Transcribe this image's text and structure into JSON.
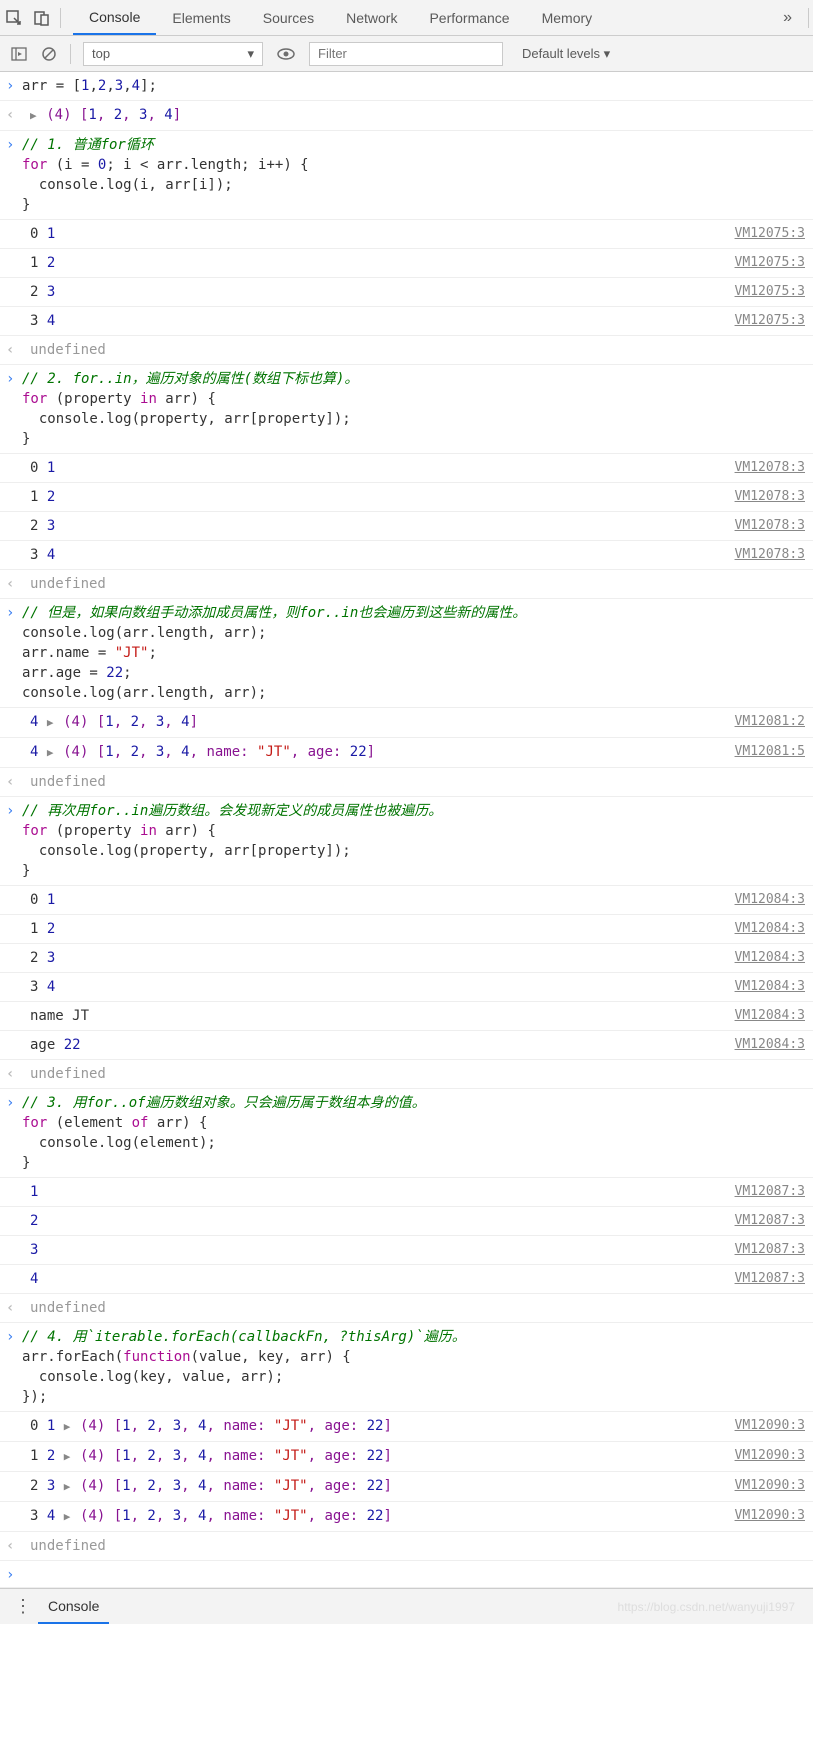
{
  "toolbar": {
    "tabs": [
      "Console",
      "Elements",
      "Sources",
      "Network",
      "Performance",
      "Memory"
    ],
    "active_tab": "Console"
  },
  "subbar": {
    "context": "top",
    "filter_placeholder": "Filter",
    "levels": "Default levels ▾"
  },
  "drawer": {
    "tab": "Console"
  },
  "watermark": "https://blog.csdn.net/wanyuji1997",
  "rows": [
    {
      "t": "in",
      "segs": [
        {
          "txt": "arr = [",
          "cls": ""
        },
        {
          "txt": "1",
          "cls": "num"
        },
        {
          "txt": ",",
          "cls": ""
        },
        {
          "txt": "2",
          "cls": "num"
        },
        {
          "txt": ",",
          "cls": ""
        },
        {
          "txt": "3",
          "cls": "num"
        },
        {
          "txt": ",",
          "cls": ""
        },
        {
          "txt": "4",
          "cls": "num"
        },
        {
          "txt": "];",
          "cls": ""
        }
      ]
    },
    {
      "t": "out",
      "segs": [
        {
          "txt": "▶ ",
          "cls": "tri"
        },
        {
          "txt": "(4) ",
          "cls": "propname"
        },
        {
          "txt": "[",
          "cls": "propname"
        },
        {
          "txt": "1",
          "cls": "num"
        },
        {
          "txt": ", ",
          "cls": "propname"
        },
        {
          "txt": "2",
          "cls": "num"
        },
        {
          "txt": ", ",
          "cls": "propname"
        },
        {
          "txt": "3",
          "cls": "num"
        },
        {
          "txt": ", ",
          "cls": "propname"
        },
        {
          "txt": "4",
          "cls": "num"
        },
        {
          "txt": "]",
          "cls": "propname"
        }
      ]
    },
    {
      "t": "in",
      "segs": [
        {
          "txt": "// 1. 普通for循环",
          "cls": "comment"
        },
        {
          "txt": "\n",
          "cls": ""
        },
        {
          "txt": "for",
          "cls": "kw"
        },
        {
          "txt": " (i = ",
          "cls": ""
        },
        {
          "txt": "0",
          "cls": "num"
        },
        {
          "txt": "; i < arr.length; i++) {\n  console.log(i, arr[i]);\n}",
          "cls": ""
        }
      ]
    },
    {
      "t": "log",
      "src": "VM12075:3",
      "segs": [
        {
          "txt": "0 ",
          "cls": ""
        },
        {
          "txt": "1",
          "cls": "num"
        }
      ]
    },
    {
      "t": "log",
      "src": "VM12075:3",
      "segs": [
        {
          "txt": "1 ",
          "cls": ""
        },
        {
          "txt": "2",
          "cls": "num"
        }
      ]
    },
    {
      "t": "log",
      "src": "VM12075:3",
      "segs": [
        {
          "txt": "2 ",
          "cls": ""
        },
        {
          "txt": "3",
          "cls": "num"
        }
      ]
    },
    {
      "t": "log",
      "src": "VM12075:3",
      "segs": [
        {
          "txt": "3 ",
          "cls": ""
        },
        {
          "txt": "4",
          "cls": "num"
        }
      ]
    },
    {
      "t": "out",
      "segs": [
        {
          "txt": "undefined",
          "cls": "undef"
        }
      ]
    },
    {
      "t": "in",
      "segs": [
        {
          "txt": "// 2. for..in，遍历对象的属性(数组下标也算)。",
          "cls": "comment"
        },
        {
          "txt": "\n",
          "cls": ""
        },
        {
          "txt": "for",
          "cls": "kw"
        },
        {
          "txt": " (property ",
          "cls": ""
        },
        {
          "txt": "in",
          "cls": "kw"
        },
        {
          "txt": " arr) {\n  console.log(property, arr[property]);\n}",
          "cls": ""
        }
      ]
    },
    {
      "t": "log",
      "src": "VM12078:3",
      "segs": [
        {
          "txt": "0 ",
          "cls": ""
        },
        {
          "txt": "1",
          "cls": "num"
        }
      ]
    },
    {
      "t": "log",
      "src": "VM12078:3",
      "segs": [
        {
          "txt": "1 ",
          "cls": ""
        },
        {
          "txt": "2",
          "cls": "num"
        }
      ]
    },
    {
      "t": "log",
      "src": "VM12078:3",
      "segs": [
        {
          "txt": "2 ",
          "cls": ""
        },
        {
          "txt": "3",
          "cls": "num"
        }
      ]
    },
    {
      "t": "log",
      "src": "VM12078:3",
      "segs": [
        {
          "txt": "3 ",
          "cls": ""
        },
        {
          "txt": "4",
          "cls": "num"
        }
      ]
    },
    {
      "t": "out",
      "segs": [
        {
          "txt": "undefined",
          "cls": "undef"
        }
      ]
    },
    {
      "t": "in",
      "segs": [
        {
          "txt": "// 但是，如果向数组手动添加成员属性，则for..in也会遍历到这些新的属性。",
          "cls": "comment"
        },
        {
          "txt": "\n",
          "cls": ""
        },
        {
          "txt": "console.log(arr.length, arr);\narr.name = ",
          "cls": ""
        },
        {
          "txt": "\"JT\"",
          "cls": "str"
        },
        {
          "txt": ";\narr.age = ",
          "cls": ""
        },
        {
          "txt": "22",
          "cls": "num"
        },
        {
          "txt": ";\nconsole.log(arr.length, arr);",
          "cls": ""
        }
      ]
    },
    {
      "t": "log",
      "src": "VM12081:2",
      "segs": [
        {
          "txt": "4 ",
          "cls": "num"
        },
        {
          "txt": "▶ ",
          "cls": "tri"
        },
        {
          "txt": "(4) ",
          "cls": "propname"
        },
        {
          "txt": "[",
          "cls": "propname"
        },
        {
          "txt": "1",
          "cls": "num"
        },
        {
          "txt": ", ",
          "cls": "propname"
        },
        {
          "txt": "2",
          "cls": "num"
        },
        {
          "txt": ", ",
          "cls": "propname"
        },
        {
          "txt": "3",
          "cls": "num"
        },
        {
          "txt": ", ",
          "cls": "propname"
        },
        {
          "txt": "4",
          "cls": "num"
        },
        {
          "txt": "]",
          "cls": "propname"
        }
      ]
    },
    {
      "t": "log",
      "src": "VM12081:5",
      "segs": [
        {
          "txt": "4 ",
          "cls": "num"
        },
        {
          "txt": "▶ ",
          "cls": "tri"
        },
        {
          "txt": "(4) ",
          "cls": "propname"
        },
        {
          "txt": "[",
          "cls": "propname"
        },
        {
          "txt": "1",
          "cls": "num"
        },
        {
          "txt": ", ",
          "cls": "propname"
        },
        {
          "txt": "2",
          "cls": "num"
        },
        {
          "txt": ", ",
          "cls": "propname"
        },
        {
          "txt": "3",
          "cls": "num"
        },
        {
          "txt": ", ",
          "cls": "propname"
        },
        {
          "txt": "4",
          "cls": "num"
        },
        {
          "txt": ", ",
          "cls": "propname"
        },
        {
          "txt": "name",
          "cls": "propname"
        },
        {
          "txt": ": ",
          "cls": "propname"
        },
        {
          "txt": "\"JT\"",
          "cls": "str"
        },
        {
          "txt": ", ",
          "cls": "propname"
        },
        {
          "txt": "age",
          "cls": "propname"
        },
        {
          "txt": ": ",
          "cls": "propname"
        },
        {
          "txt": "22",
          "cls": "num"
        },
        {
          "txt": "]",
          "cls": "propname"
        }
      ]
    },
    {
      "t": "out",
      "segs": [
        {
          "txt": "undefined",
          "cls": "undef"
        }
      ]
    },
    {
      "t": "in",
      "segs": [
        {
          "txt": "// 再次用for..in遍历数组。会发现新定义的成员属性也被遍历。",
          "cls": "comment"
        },
        {
          "txt": "\n",
          "cls": ""
        },
        {
          "txt": "for",
          "cls": "kw"
        },
        {
          "txt": " (property ",
          "cls": ""
        },
        {
          "txt": "in",
          "cls": "kw"
        },
        {
          "txt": " arr) {\n  console.log(property, arr[property]);\n}",
          "cls": ""
        }
      ]
    },
    {
      "t": "log",
      "src": "VM12084:3",
      "segs": [
        {
          "txt": "0 ",
          "cls": ""
        },
        {
          "txt": "1",
          "cls": "num"
        }
      ]
    },
    {
      "t": "log",
      "src": "VM12084:3",
      "segs": [
        {
          "txt": "1 ",
          "cls": ""
        },
        {
          "txt": "2",
          "cls": "num"
        }
      ]
    },
    {
      "t": "log",
      "src": "VM12084:3",
      "segs": [
        {
          "txt": "2 ",
          "cls": ""
        },
        {
          "txt": "3",
          "cls": "num"
        }
      ]
    },
    {
      "t": "log",
      "src": "VM12084:3",
      "segs": [
        {
          "txt": "3 ",
          "cls": ""
        },
        {
          "txt": "4",
          "cls": "num"
        }
      ]
    },
    {
      "t": "log",
      "src": "VM12084:3",
      "segs": [
        {
          "txt": "name JT",
          "cls": ""
        }
      ]
    },
    {
      "t": "log",
      "src": "VM12084:3",
      "segs": [
        {
          "txt": "age ",
          "cls": ""
        },
        {
          "txt": "22",
          "cls": "num"
        }
      ]
    },
    {
      "t": "out",
      "segs": [
        {
          "txt": "undefined",
          "cls": "undef"
        }
      ]
    },
    {
      "t": "in",
      "segs": [
        {
          "txt": "// 3. 用for..of遍历数组对象。只会遍历属于数组本身的值。",
          "cls": "comment"
        },
        {
          "txt": "\n",
          "cls": ""
        },
        {
          "txt": "for",
          "cls": "kw"
        },
        {
          "txt": " (element ",
          "cls": ""
        },
        {
          "txt": "of",
          "cls": "kw"
        },
        {
          "txt": " arr) {\n  console.log(element);\n}",
          "cls": ""
        }
      ]
    },
    {
      "t": "log",
      "src": "VM12087:3",
      "segs": [
        {
          "txt": "1",
          "cls": "num"
        }
      ]
    },
    {
      "t": "log",
      "src": "VM12087:3",
      "segs": [
        {
          "txt": "2",
          "cls": "num"
        }
      ]
    },
    {
      "t": "log",
      "src": "VM12087:3",
      "segs": [
        {
          "txt": "3",
          "cls": "num"
        }
      ]
    },
    {
      "t": "log",
      "src": "VM12087:3",
      "segs": [
        {
          "txt": "4",
          "cls": "num"
        }
      ]
    },
    {
      "t": "out",
      "segs": [
        {
          "txt": "undefined",
          "cls": "undef"
        }
      ]
    },
    {
      "t": "in",
      "segs": [
        {
          "txt": "// 4. 用`iterable.forEach(callbackFn, ?thisArg)`遍历。",
          "cls": "comment"
        },
        {
          "txt": "\n",
          "cls": ""
        },
        {
          "txt": "arr.forEach(",
          "cls": ""
        },
        {
          "txt": "function",
          "cls": "kw"
        },
        {
          "txt": "(value, key, arr) {\n  console.log(key, value, arr);\n});",
          "cls": ""
        }
      ]
    },
    {
      "t": "log",
      "src": "VM12090:3",
      "segs": [
        {
          "txt": "0 ",
          "cls": ""
        },
        {
          "txt": "1 ",
          "cls": "num"
        },
        {
          "txt": "▶ ",
          "cls": "tri"
        },
        {
          "txt": "(4) ",
          "cls": "propname"
        },
        {
          "txt": "[",
          "cls": "propname"
        },
        {
          "txt": "1",
          "cls": "num"
        },
        {
          "txt": ", ",
          "cls": "propname"
        },
        {
          "txt": "2",
          "cls": "num"
        },
        {
          "txt": ", ",
          "cls": "propname"
        },
        {
          "txt": "3",
          "cls": "num"
        },
        {
          "txt": ", ",
          "cls": "propname"
        },
        {
          "txt": "4",
          "cls": "num"
        },
        {
          "txt": ", ",
          "cls": "propname"
        },
        {
          "txt": "name",
          "cls": "propname"
        },
        {
          "txt": ": ",
          "cls": "propname"
        },
        {
          "txt": "\"JT\"",
          "cls": "str"
        },
        {
          "txt": ", ",
          "cls": "propname"
        },
        {
          "txt": "age",
          "cls": "propname"
        },
        {
          "txt": ": ",
          "cls": "propname"
        },
        {
          "txt": "22",
          "cls": "num"
        },
        {
          "txt": "]",
          "cls": "propname"
        }
      ]
    },
    {
      "t": "log",
      "src": "VM12090:3",
      "segs": [
        {
          "txt": "1 ",
          "cls": ""
        },
        {
          "txt": "2 ",
          "cls": "num"
        },
        {
          "txt": "▶ ",
          "cls": "tri"
        },
        {
          "txt": "(4) ",
          "cls": "propname"
        },
        {
          "txt": "[",
          "cls": "propname"
        },
        {
          "txt": "1",
          "cls": "num"
        },
        {
          "txt": ", ",
          "cls": "propname"
        },
        {
          "txt": "2",
          "cls": "num"
        },
        {
          "txt": ", ",
          "cls": "propname"
        },
        {
          "txt": "3",
          "cls": "num"
        },
        {
          "txt": ", ",
          "cls": "propname"
        },
        {
          "txt": "4",
          "cls": "num"
        },
        {
          "txt": ", ",
          "cls": "propname"
        },
        {
          "txt": "name",
          "cls": "propname"
        },
        {
          "txt": ": ",
          "cls": "propname"
        },
        {
          "txt": "\"JT\"",
          "cls": "str"
        },
        {
          "txt": ", ",
          "cls": "propname"
        },
        {
          "txt": "age",
          "cls": "propname"
        },
        {
          "txt": ": ",
          "cls": "propname"
        },
        {
          "txt": "22",
          "cls": "num"
        },
        {
          "txt": "]",
          "cls": "propname"
        }
      ]
    },
    {
      "t": "log",
      "src": "VM12090:3",
      "segs": [
        {
          "txt": "2 ",
          "cls": ""
        },
        {
          "txt": "3 ",
          "cls": "num"
        },
        {
          "txt": "▶ ",
          "cls": "tri"
        },
        {
          "txt": "(4) ",
          "cls": "propname"
        },
        {
          "txt": "[",
          "cls": "propname"
        },
        {
          "txt": "1",
          "cls": "num"
        },
        {
          "txt": ", ",
          "cls": "propname"
        },
        {
          "txt": "2",
          "cls": "num"
        },
        {
          "txt": ", ",
          "cls": "propname"
        },
        {
          "txt": "3",
          "cls": "num"
        },
        {
          "txt": ", ",
          "cls": "propname"
        },
        {
          "txt": "4",
          "cls": "num"
        },
        {
          "txt": ", ",
          "cls": "propname"
        },
        {
          "txt": "name",
          "cls": "propname"
        },
        {
          "txt": ": ",
          "cls": "propname"
        },
        {
          "txt": "\"JT\"",
          "cls": "str"
        },
        {
          "txt": ", ",
          "cls": "propname"
        },
        {
          "txt": "age",
          "cls": "propname"
        },
        {
          "txt": ": ",
          "cls": "propname"
        },
        {
          "txt": "22",
          "cls": "num"
        },
        {
          "txt": "]",
          "cls": "propname"
        }
      ]
    },
    {
      "t": "log",
      "src": "VM12090:3",
      "segs": [
        {
          "txt": "3 ",
          "cls": ""
        },
        {
          "txt": "4 ",
          "cls": "num"
        },
        {
          "txt": "▶ ",
          "cls": "tri"
        },
        {
          "txt": "(4) ",
          "cls": "propname"
        },
        {
          "txt": "[",
          "cls": "propname"
        },
        {
          "txt": "1",
          "cls": "num"
        },
        {
          "txt": ", ",
          "cls": "propname"
        },
        {
          "txt": "2",
          "cls": "num"
        },
        {
          "txt": ", ",
          "cls": "propname"
        },
        {
          "txt": "3",
          "cls": "num"
        },
        {
          "txt": ", ",
          "cls": "propname"
        },
        {
          "txt": "4",
          "cls": "num"
        },
        {
          "txt": ", ",
          "cls": "propname"
        },
        {
          "txt": "name",
          "cls": "propname"
        },
        {
          "txt": ": ",
          "cls": "propname"
        },
        {
          "txt": "\"JT\"",
          "cls": "str"
        },
        {
          "txt": ", ",
          "cls": "propname"
        },
        {
          "txt": "age",
          "cls": "propname"
        },
        {
          "txt": ": ",
          "cls": "propname"
        },
        {
          "txt": "22",
          "cls": "num"
        },
        {
          "txt": "]",
          "cls": "propname"
        }
      ]
    },
    {
      "t": "out",
      "segs": [
        {
          "txt": "undefined",
          "cls": "undef"
        }
      ]
    },
    {
      "t": "prompt",
      "segs": []
    }
  ]
}
